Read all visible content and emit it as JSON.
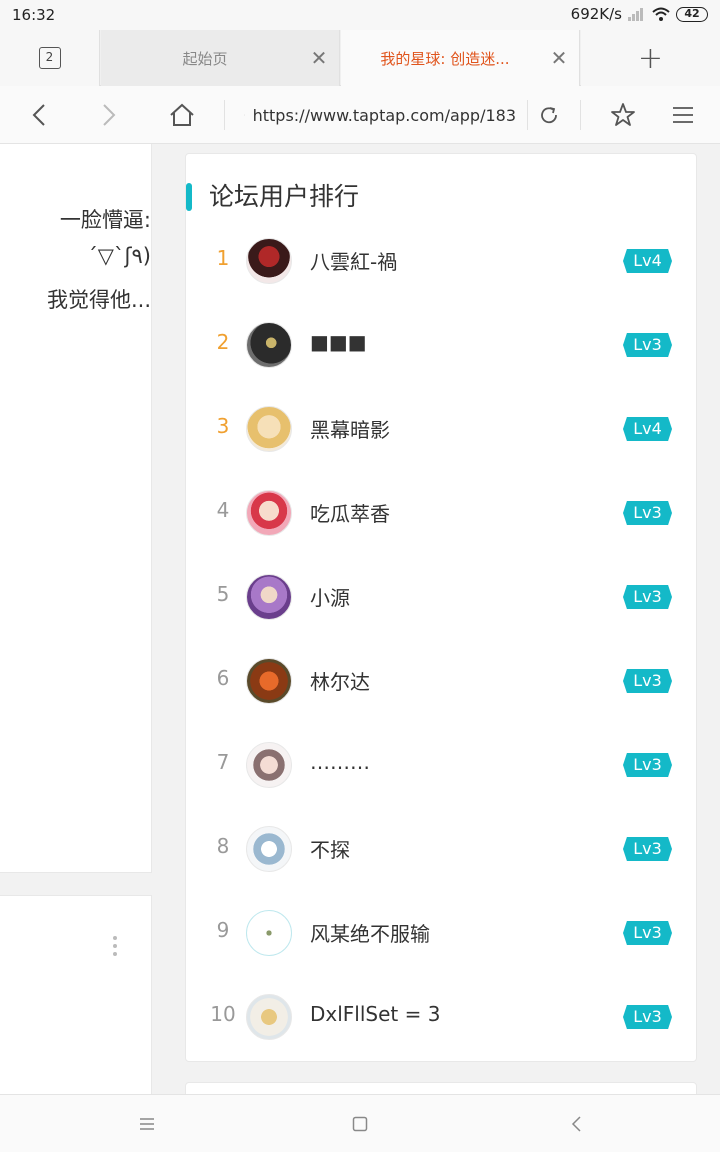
{
  "status_bar": {
    "time": "16:32",
    "speed": "692K/s",
    "battery": "42"
  },
  "tabs": {
    "count": "2",
    "items": [
      {
        "title": "起始页",
        "active": false
      },
      {
        "title": "我的星球: 创造迷...",
        "active": true
      }
    ],
    "new_tab_label": "+"
  },
  "url_bar": {
    "url": "https://www.taptap.com/app/183"
  },
  "left_panel": {
    "lines": [
      "一脸懵逼:",
      "´▽`ʃ٩)",
      "我觉得他..."
    ]
  },
  "ranking": {
    "title": "论坛用户排行",
    "users": [
      {
        "rank": "1",
        "name": "八雲紅-禍",
        "level": "Lv4"
      },
      {
        "rank": "2",
        "name": "■■■",
        "level": "Lv3"
      },
      {
        "rank": "3",
        "name": "黑幕暗影",
        "level": "Lv4"
      },
      {
        "rank": "4",
        "name": "吃瓜萃香",
        "level": "Lv3"
      },
      {
        "rank": "5",
        "name": "小源",
        "level": "Lv3"
      },
      {
        "rank": "6",
        "name": "林尔达",
        "level": "Lv3"
      },
      {
        "rank": "7",
        "name": "………",
        "level": "Lv3"
      },
      {
        "rank": "8",
        "name": "不探",
        "level": "Lv3"
      },
      {
        "rank": "9",
        "name": "风某绝不服输",
        "level": "Lv3"
      },
      {
        "rank": "10",
        "name": "DxlFllSet = 3",
        "level": "Lv3"
      }
    ]
  },
  "colors": {
    "accent": "#14b9c8",
    "top_rank": "#f0a030",
    "active_tab": "#e0541c"
  }
}
